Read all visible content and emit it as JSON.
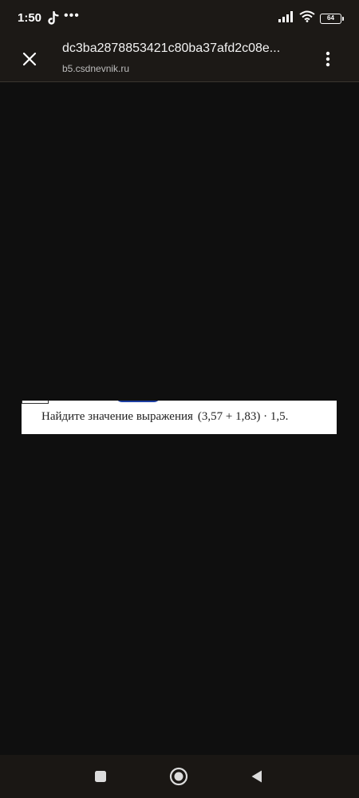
{
  "status_bar": {
    "time": "1:50",
    "dots": "•••",
    "battery": "64",
    "icons": [
      "tiktok-icon",
      "signal-icon",
      "wifi-icon",
      "battery-icon"
    ]
  },
  "header": {
    "title": "dc3ba2878853421c80ba37afd2c08e...",
    "domain": "b5.csdnevnik.ru",
    "icons": [
      "close-icon",
      "more-vert-icon"
    ]
  },
  "content": {
    "problem_text": "Найдите значение выражения",
    "expression": "(3,57 + 1,83) · 1,5."
  },
  "nav_bar": {
    "icons": [
      "recents-square-icon",
      "home-circle-icon",
      "back-triangle-icon"
    ]
  },
  "colors": {
    "background": "#0f0f0f",
    "bar_background": "#1c1916",
    "text_primary": "#ffffff",
    "image_background": "#ffffff"
  }
}
